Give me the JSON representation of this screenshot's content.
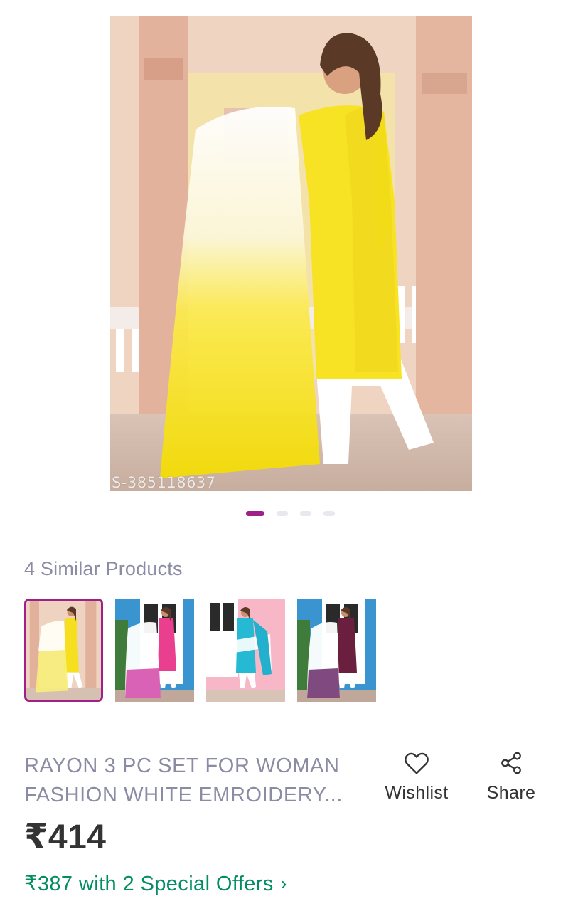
{
  "product": {
    "watermark_id": "S-385118637",
    "title_line1": "RAYON 3 PC SET FOR WOMAN",
    "title_line2": "FASHION WHITE EMROIDERY...",
    "price": "₹414",
    "offer_text": "₹387 with 2 Special Offers",
    "offer_chevron": "›"
  },
  "carousel": {
    "dot_count": 4,
    "active_index": 0
  },
  "similar": {
    "title": "4 Similar Products",
    "items": [
      {
        "color": "yellow",
        "selected": true
      },
      {
        "color": "pink",
        "selected": false
      },
      {
        "color": "sky-blue",
        "selected": false
      },
      {
        "color": "maroon",
        "selected": false
      }
    ]
  },
  "actions": {
    "wishlist_label": "Wishlist",
    "share_label": "Share"
  },
  "colors": {
    "brand_accent": "#9f2089",
    "offer_green": "#038d63",
    "muted_text": "#8b8ba3"
  },
  "icons": {
    "wishlist": "heart-outline-icon",
    "share": "share-nodes-icon",
    "offer": "chevron-right-icon"
  }
}
